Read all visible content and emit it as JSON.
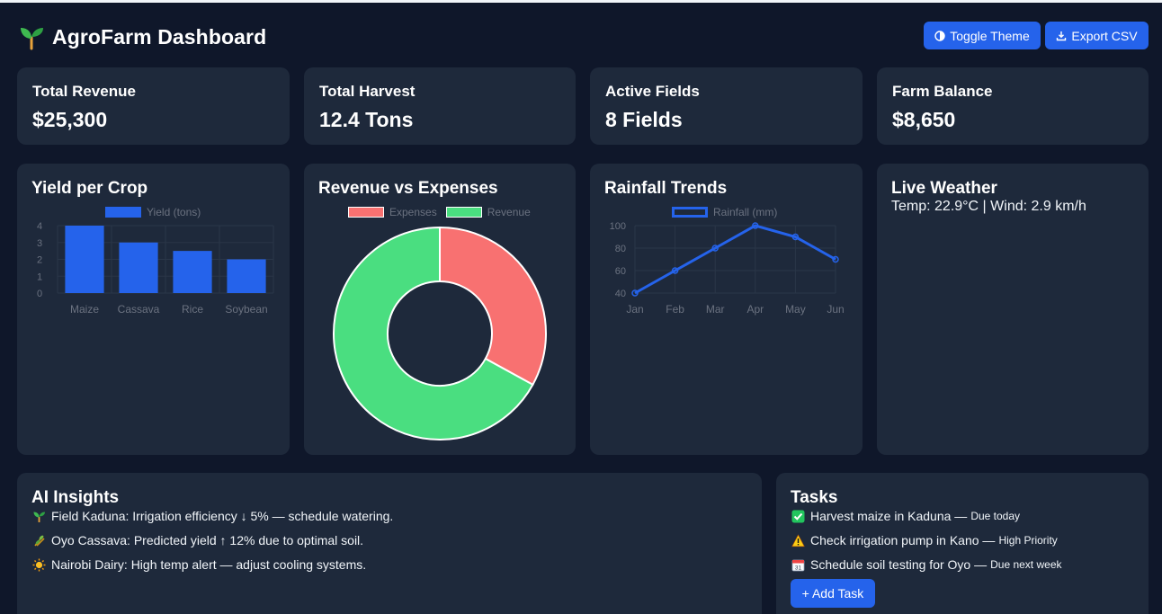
{
  "app": {
    "title": "AgroFarm Dashboard",
    "buttons": {
      "toggle_theme": "Toggle Theme",
      "export_csv": "Export CSV"
    }
  },
  "stats": [
    {
      "title": "Total Revenue",
      "value": "$25,300"
    },
    {
      "title": "Total Harvest",
      "value": "12.4 Tons"
    },
    {
      "title": "Active Fields",
      "value": "8 Fields"
    },
    {
      "title": "Farm Balance",
      "value": "$8,650"
    }
  ],
  "cards": {
    "yield_title": "Yield per Crop",
    "revexp_title": "Revenue vs Expenses",
    "rainfall_title": "Rainfall Trends",
    "weather_title": "Live Weather",
    "weather_text": "Temp: 22.9°C | Wind: 2.9 km/h"
  },
  "chart_data": [
    {
      "type": "bar",
      "categories": [
        "Maize",
        "Cassava",
        "Rice",
        "Soybean"
      ],
      "series": [
        {
          "name": "Yield (tons)",
          "values": [
            4.0,
            3.0,
            2.5,
            2.0
          ],
          "color": "#2563eb"
        }
      ],
      "yticks": [
        0,
        1,
        2,
        3,
        4
      ],
      "ylim": [
        0,
        4
      ]
    },
    {
      "type": "pie",
      "donut": true,
      "labels": [
        "Expenses",
        "Revenue"
      ],
      "values": [
        33,
        67
      ],
      "colors": [
        "#f87171",
        "#4ade80"
      ]
    },
    {
      "type": "line",
      "categories": [
        "Jan",
        "Feb",
        "Mar",
        "Apr",
        "May",
        "Jun"
      ],
      "series": [
        {
          "name": "Rainfall (mm)",
          "values": [
            40,
            60,
            80,
            100,
            90,
            70
          ],
          "color": "#2563eb"
        }
      ],
      "yticks": [
        40,
        60,
        80,
        100
      ],
      "ylim": [
        40,
        100
      ]
    }
  ],
  "insights": {
    "title": "AI Insights",
    "items": [
      {
        "icon": "seedling-icon",
        "text": "Field Kaduna: Irrigation efficiency ↓ 5% — schedule watering."
      },
      {
        "icon": "sheaf-icon",
        "text": "Oyo Cassava: Predicted yield ↑ 12% due to optimal soil."
      },
      {
        "icon": "sun-icon",
        "text": "Nairobi Dairy: High temp alert — adjust cooling systems."
      }
    ]
  },
  "tasks": {
    "title": "Tasks",
    "items": [
      {
        "icon": "check-icon",
        "text": "Harvest maize in Kaduna —",
        "due": "Due today"
      },
      {
        "icon": "warning-icon",
        "text": "Check irrigation pump in Kano —",
        "due": "High Priority"
      },
      {
        "icon": "calendar-icon",
        "text": "Schedule soil testing for Oyo —",
        "due": "Due next week"
      }
    ],
    "add_label": "+ Add Task"
  }
}
